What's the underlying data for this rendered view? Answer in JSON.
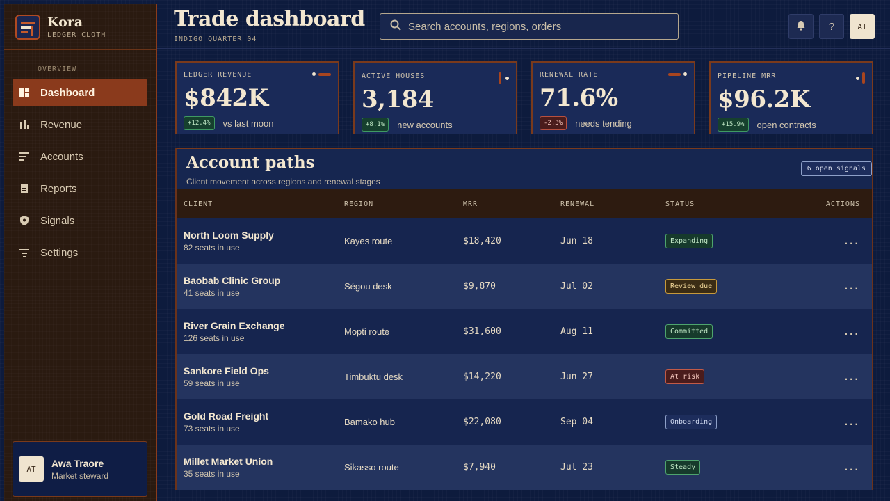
{
  "brand": {
    "name": "Kora",
    "sub": "LEDGER CLOTH"
  },
  "sidebar": {
    "section": "OVERVIEW",
    "items": [
      {
        "label": "Dashboard",
        "icon": "dashboard-icon",
        "active": true
      },
      {
        "label": "Revenue",
        "icon": "bar-chart-icon"
      },
      {
        "label": "Accounts",
        "icon": "list-icon"
      },
      {
        "label": "Reports",
        "icon": "document-icon"
      },
      {
        "label": "Signals",
        "icon": "shield-icon"
      },
      {
        "label": "Settings",
        "icon": "filter-icon"
      }
    ],
    "user": {
      "initials": "AT",
      "name": "Awa Traore",
      "role": "Market steward"
    }
  },
  "header": {
    "title": "Trade dashboard",
    "subtitle": "INDIGO QUARTER 04",
    "search_placeholder": "Search accounts, regions, orders",
    "help_glyph": "?",
    "avatar_initials": "AT"
  },
  "kpis": [
    {
      "label": "LEDGER REVENUE",
      "value": "$842K",
      "delta": "+12.4%",
      "note": "vs last moon"
    },
    {
      "label": "ACTIVE HOUSES",
      "value": "3,184",
      "delta": "+8.1%",
      "note": "new accounts"
    },
    {
      "label": "RENEWAL RATE",
      "value": "71.6%",
      "delta": "-2.3%",
      "note": "needs tending"
    },
    {
      "label": "PIPELINE MRR",
      "value": "$96.2K",
      "delta": "+15.9%",
      "note": "open contracts"
    }
  ],
  "table": {
    "title": "Account paths",
    "subtitle": "Client movement across regions and renewal stages",
    "badge": "6 open signals",
    "columns": [
      "CLIENT",
      "REGION",
      "MRR",
      "RENEWAL",
      "STATUS",
      "ACTIONS"
    ],
    "rows": [
      {
        "client": "North Loom Supply",
        "seats": "82 seats in use",
        "region": "Kayes route",
        "mrr": "$18,420",
        "renewal": "Jun 18",
        "status": "Expanding"
      },
      {
        "client": "Baobab Clinic Group",
        "seats": "41 seats in use",
        "region": "Ségou desk",
        "mrr": "$9,870",
        "renewal": "Jul 02",
        "status": "Review due"
      },
      {
        "client": "River Grain Exchange",
        "seats": "126 seats in use",
        "region": "Mopti route",
        "mrr": "$31,600",
        "renewal": "Aug 11",
        "status": "Committed"
      },
      {
        "client": "Sankore Field Ops",
        "seats": "59 seats in use",
        "region": "Timbuktu desk",
        "mrr": "$14,220",
        "renewal": "Jun 27",
        "status": "At risk"
      },
      {
        "client": "Gold Road Freight",
        "seats": "73 seats in use",
        "region": "Bamako hub",
        "mrr": "$22,080",
        "renewal": "Sep 04",
        "status": "Onboarding"
      },
      {
        "client": "Millet Market Union",
        "seats": "35 seats in use",
        "region": "Sikasso route",
        "mrr": "$7,940",
        "renewal": "Jul 23",
        "status": "Steady"
      }
    ],
    "action_glyph": "..."
  },
  "colors": {
    "accent": "#8a3a1c",
    "background": "#0d1b3d",
    "sidebar": "#2a1a10",
    "positive": "#4ea46e",
    "negative": "#c25a47",
    "warning": "#c79a3c",
    "info": "#8ea0c8"
  }
}
